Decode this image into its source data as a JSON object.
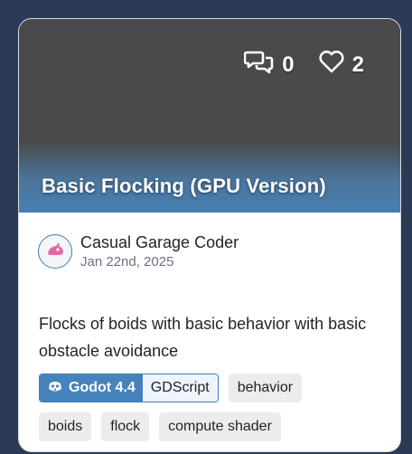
{
  "card": {
    "title": "Basic Flocking (GPU Version)",
    "comment_count": "0",
    "like_count": "2",
    "author": "Casual Garage Coder",
    "date": "Jan 22nd, 2025",
    "description": "Flocks of boids with basic behavior with basic obstacle avoidance",
    "engine": {
      "name": "Godot 4.4",
      "language": "GDScript"
    },
    "tags": [
      "behavior",
      "boids",
      "flock",
      "compute shader"
    ]
  },
  "colors": {
    "page_background": "#2b3a55",
    "accent_blue": "#4682bb",
    "tag_background": "#ececec"
  },
  "icons": [
    "comments-icon",
    "heart-icon",
    "avatar-icon",
    "godot-icon"
  ]
}
